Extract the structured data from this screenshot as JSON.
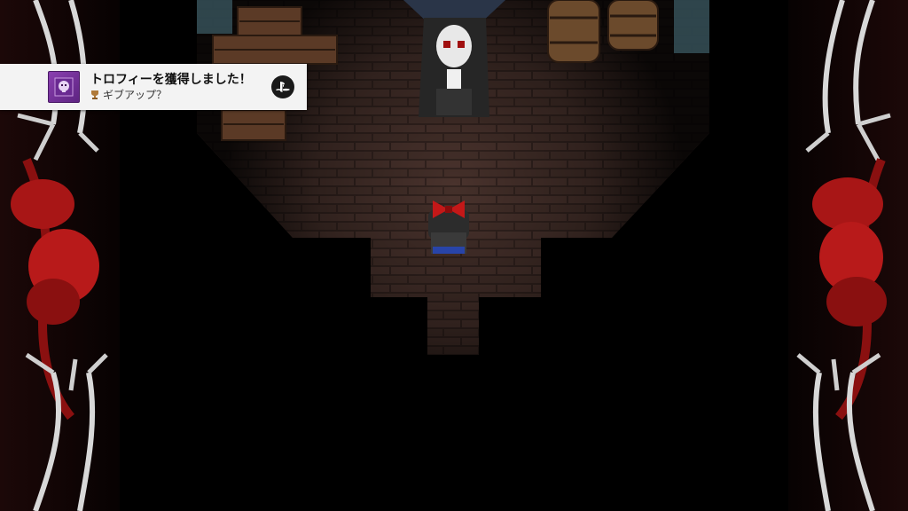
{
  "trophy": {
    "title": "トロフィーを獲得しました！",
    "name": "ギブアップ？",
    "icon": "trophy-skull-icon",
    "grade_icon": "bronze-cup-icon",
    "platform_icon": "playstation-logo-icon"
  },
  "colors": {
    "background": "#000000",
    "floor_brick": "#3a2824",
    "ribbon_red": "#b01818",
    "toast_bg": "#f3f3f3",
    "trophy_purple": "#7a3aa8"
  }
}
